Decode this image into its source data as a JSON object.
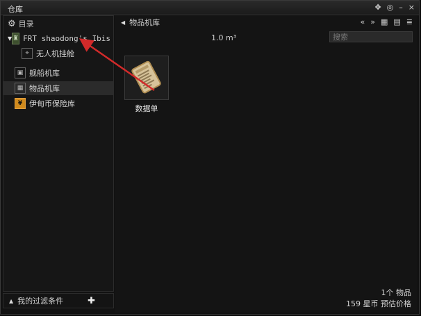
{
  "window": {
    "title": "仓库"
  },
  "window_controls": [
    "✥",
    "◎",
    "–",
    "×"
  ],
  "sidebar": {
    "header_label": "目录",
    "ship_name": "FRT shaodong's Ibis (",
    "items": [
      {
        "label": "无人机挂舱"
      },
      {
        "label": "舰船机库"
      },
      {
        "label": "物品机库"
      },
      {
        "label": "伊甸币保险库"
      }
    ],
    "footer_label": "我的过滤条件"
  },
  "main": {
    "title": "物品机库",
    "view_controls": [
      "«",
      "»",
      "▦",
      "▤",
      "≣"
    ],
    "capacity": "1.0 m³",
    "search_placeholder": "搜索",
    "item": {
      "label": "数据单"
    },
    "status": {
      "count": "1个 物品",
      "price": "159 星币 预估价格"
    }
  },
  "colors": {
    "selected_row": "#2b2b2b",
    "annotation_arrow": "#d22a2a",
    "isk_icon": "#d08a1c"
  }
}
